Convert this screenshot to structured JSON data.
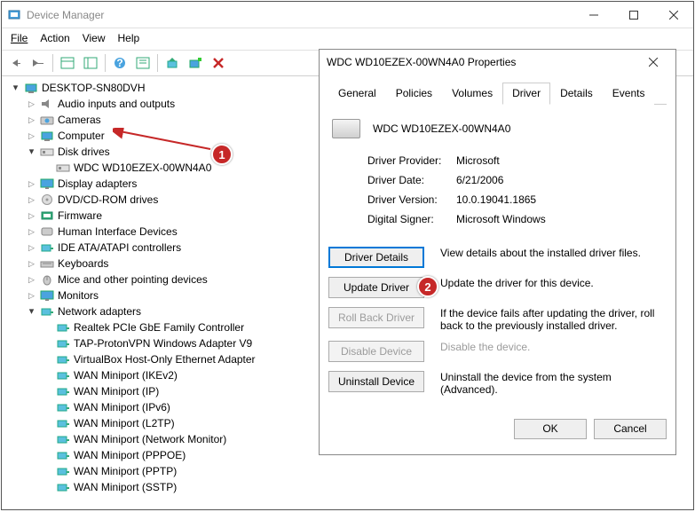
{
  "titlebar": {
    "title": "Device Manager"
  },
  "menu": {
    "file": "File",
    "action": "Action",
    "view": "View",
    "help": "Help"
  },
  "tree": {
    "root": "DESKTOP-SN80DVH",
    "items": [
      {
        "label": "Audio inputs and outputs"
      },
      {
        "label": "Cameras"
      },
      {
        "label": "Computer"
      },
      {
        "label": "Disk drives",
        "expanded": true,
        "children": [
          {
            "label": "WDC WD10EZEX-00WN4A0"
          }
        ]
      },
      {
        "label": "Display adapters"
      },
      {
        "label": "DVD/CD-ROM drives"
      },
      {
        "label": "Firmware"
      },
      {
        "label": "Human Interface Devices"
      },
      {
        "label": "IDE ATA/ATAPI controllers"
      },
      {
        "label": "Keyboards"
      },
      {
        "label": "Mice and other pointing devices"
      },
      {
        "label": "Monitors"
      },
      {
        "label": "Network adapters",
        "expanded": true,
        "children": [
          {
            "label": "Realtek PCIe GbE Family Controller"
          },
          {
            "label": "TAP-ProtonVPN Windows Adapter V9"
          },
          {
            "label": "VirtualBox Host-Only Ethernet Adapter"
          },
          {
            "label": "WAN Miniport (IKEv2)"
          },
          {
            "label": "WAN Miniport (IP)"
          },
          {
            "label": "WAN Miniport (IPv6)"
          },
          {
            "label": "WAN Miniport (L2TP)"
          },
          {
            "label": "WAN Miniport (Network Monitor)"
          },
          {
            "label": "WAN Miniport (PPPOE)"
          },
          {
            "label": "WAN Miniport (PPTP)"
          },
          {
            "label": "WAN Miniport (SSTP)"
          }
        ]
      }
    ]
  },
  "dialog": {
    "title": "WDC WD10EZEX-00WN4A0 Properties",
    "tabs": [
      "General",
      "Policies",
      "Volumes",
      "Driver",
      "Details",
      "Events"
    ],
    "active_tab": 3,
    "device_name": "WDC WD10EZEX-00WN4A0",
    "info": {
      "provider_label": "Driver Provider:",
      "provider_value": "Microsoft",
      "date_label": "Driver Date:",
      "date_value": "6/21/2006",
      "version_label": "Driver Version:",
      "version_value": "10.0.19041.1865",
      "signer_label": "Digital Signer:",
      "signer_value": "Microsoft Windows"
    },
    "buttons": {
      "details": {
        "label": "Driver Details",
        "desc": "View details about the installed driver files."
      },
      "update": {
        "label": "Update Driver",
        "desc": "Update the driver for this device."
      },
      "rollback": {
        "label": "Roll Back Driver",
        "desc": "If the device fails after updating the driver, roll back to the previously installed driver."
      },
      "disable": {
        "label": "Disable Device",
        "desc": "Disable the device."
      },
      "uninstall": {
        "label": "Uninstall Device",
        "desc": "Uninstall the device from the system (Advanced)."
      }
    },
    "ok": "OK",
    "cancel": "Cancel"
  },
  "annotations": {
    "badge1": "1",
    "badge2": "2"
  }
}
